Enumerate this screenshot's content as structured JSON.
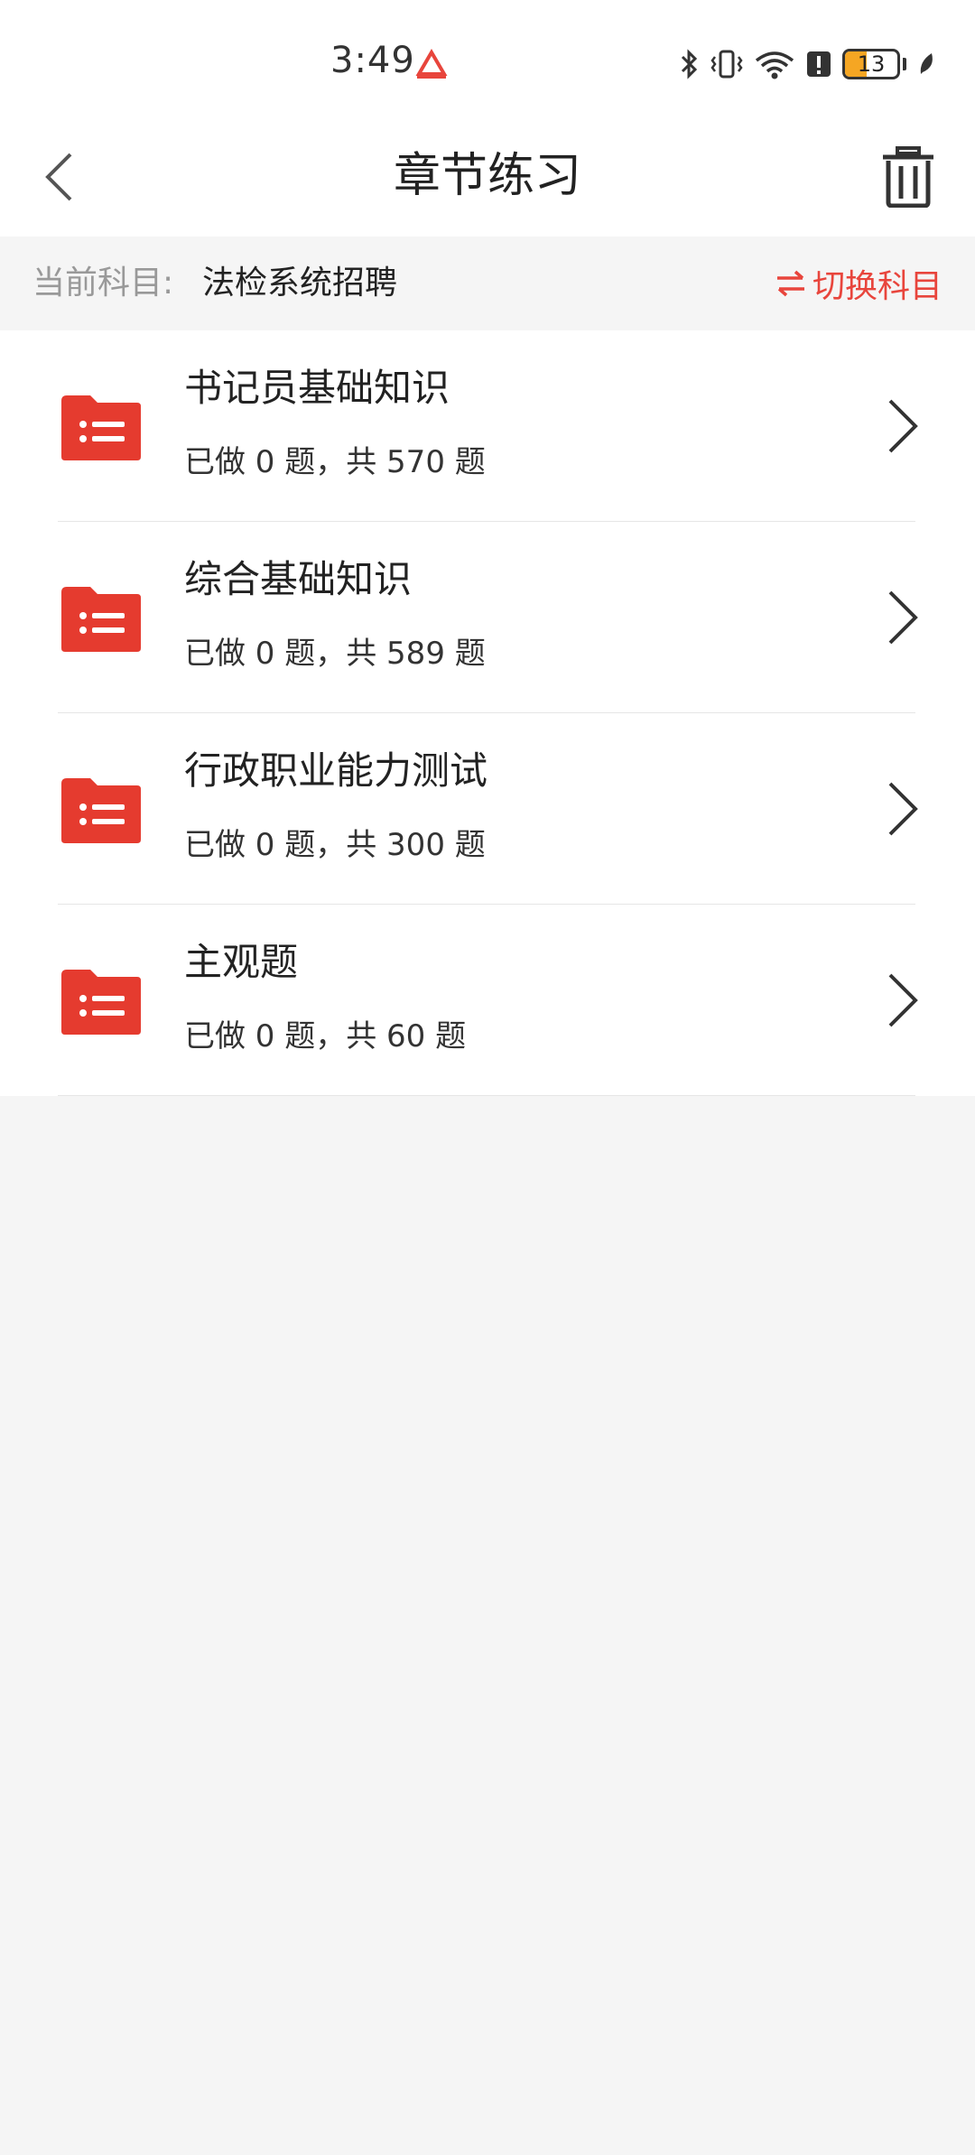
{
  "status_bar": {
    "time": "3:49",
    "battery": {
      "text": "13",
      "level": 0.13,
      "color": "#f5a623"
    },
    "icons": [
      "app-notification-icon",
      "bluetooth-icon",
      "vibrate-icon",
      "wifi-icon",
      "alert-icon",
      "battery-icon",
      "leaf-icon"
    ]
  },
  "header": {
    "title": "章节练习",
    "back_icon": "chevron-left-icon",
    "trash_icon": "trash-icon"
  },
  "subject": {
    "label": "当前科目:",
    "value": "法检系统招聘",
    "switch_label": "切换科目",
    "switch_icon": "swap-arrows-icon"
  },
  "chapters": [
    {
      "title": "书记员基础知识",
      "done": "已做 0 题，共 570 题"
    },
    {
      "title": "综合基础知识",
      "done": "已做 0 题，共 589 题"
    },
    {
      "title": "行政职业能力测试",
      "done": "已做 0 题，共 300 题"
    },
    {
      "title": "主观题",
      "done": "已做 0 题，共 60 题"
    }
  ],
  "colors": {
    "accent": "#e8453c",
    "folder": "#e53b2f",
    "background": "#f5f5f5"
  }
}
